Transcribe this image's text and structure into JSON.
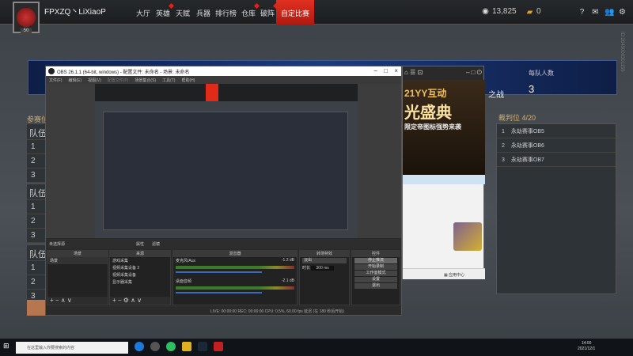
{
  "topbar": {
    "player_name": "FPXZQ丶LiXiaoP",
    "level": "50",
    "nav": [
      {
        "label": "大厅"
      },
      {
        "label": "英雄",
        "badge": true
      },
      {
        "label": "天赋"
      },
      {
        "label": "兵器"
      },
      {
        "label": "排行榜"
      },
      {
        "label": "仓库",
        "badge": true
      },
      {
        "label": "破阵",
        "badge": true
      },
      {
        "label": "自定比赛",
        "active": true
      }
    ],
    "coins": "13,825",
    "gold": "0"
  },
  "banner": {
    "mode_suffix": "之战",
    "per_team_label": "每队人数",
    "per_team_value": "3"
  },
  "participants": {
    "title": "参赛位",
    "teams": [
      {
        "label": "队伍",
        "rows": [
          "1",
          "2",
          "3"
        ]
      },
      {
        "label": "队伍",
        "rows": [
          "1",
          "2",
          "3"
        ]
      },
      {
        "label": "队伍",
        "rows": [
          "1",
          "2",
          "3"
        ]
      }
    ]
  },
  "referees": {
    "title": "裁判位 4/20",
    "rows": [
      {
        "n": "1",
        "name": "永劫赛事OB5"
      },
      {
        "n": "2",
        "name": "永劫赛事OB6"
      },
      {
        "n": "3",
        "name": "永劫赛事OB7"
      }
    ]
  },
  "obs": {
    "title": "OBS 26.1.1 (64-bit, windows) - 配置文件: 未命名 - 场景: 未命名",
    "menu": [
      "文件(F)",
      "编辑(E)",
      "视图(V)",
      "配置文件(P)",
      "场景集合(S)",
      "工具(T)",
      "帮助(H)"
    ],
    "no_source": "未选择源",
    "props": "属性",
    "filters": "滤镜",
    "scenes": {
      "title": "场景",
      "items": [
        "场景"
      ]
    },
    "sources": {
      "title": "来源",
      "items": [
        "游戏采集",
        "视频采集设备 2",
        "视频采集设备",
        "显示器采集"
      ]
    },
    "mixer": {
      "title": "混音器",
      "tracks": [
        {
          "name": "麦克风/Aux",
          "db": "-1.2 dB"
        },
        {
          "name": "桌面音频",
          "db": "-2.1 dB"
        }
      ]
    },
    "transitions": {
      "title": "转场特效",
      "type": "淡出",
      "duration_label": "时长",
      "duration": "300 ms"
    },
    "controls": {
      "title": "控件",
      "buttons": [
        "停止推流",
        "开始录制",
        "工作室模式",
        "设置",
        "退出"
      ]
    },
    "status": "LIVE: 00:00:00   REC: 00:00:00   CPU: 0.5%, 60.00 fps   延迟 (在 180 秒后开始)"
  },
  "yy": {
    "ad_line1": "21YY互动",
    "ad_line2": "光盛典",
    "ad_line3": "限定帝图标强势来袭",
    "app_center": "应用中心"
  },
  "taskbar": {
    "search_placeholder": "在这里输入你要搜索的内容",
    "time": "14:00",
    "date": "2021/12/1"
  },
  "watermark": "ID:2645000301155"
}
